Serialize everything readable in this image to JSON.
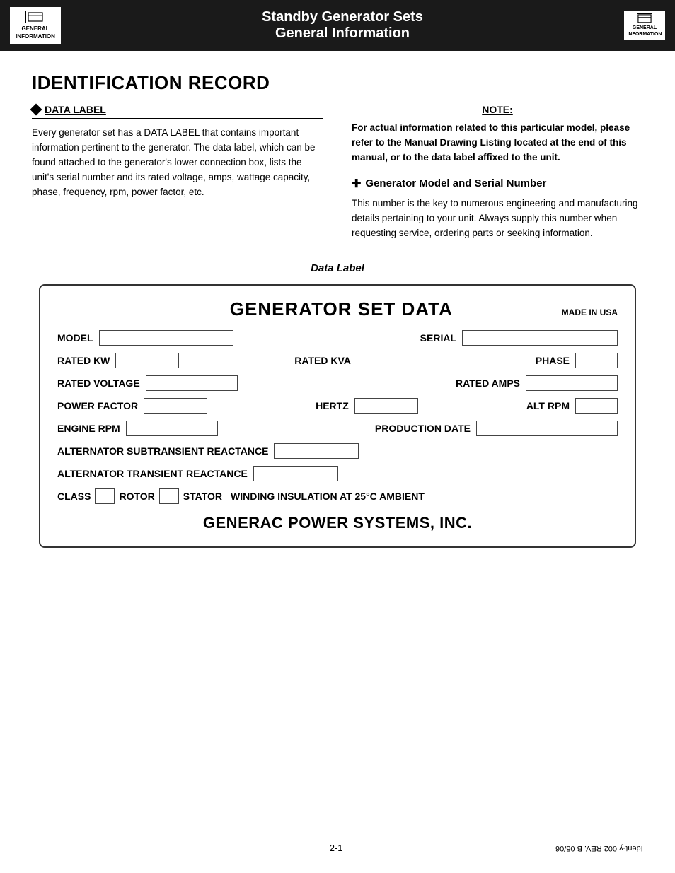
{
  "header": {
    "title_line1": "Standby Generator Sets",
    "title_line2": "General Information",
    "logo_left_line1": "GENERAL",
    "logo_left_line2": "INFORMATION",
    "logo_right_line1": "GENERAL",
    "logo_right_line2": "INFORMATION"
  },
  "identification_record": {
    "title": "IDENTIFICATION RECORD",
    "data_label_heading": "DATA LABEL",
    "data_label_body": "Every generator set has a DATA LABEL that contains important information pertinent to the generator. The data label, which can be found attached to the generator's lower connection box, lists the unit's serial number and its rated voltage, amps, wattage capacity, phase, frequency, rpm, power factor, etc.",
    "note_label": "NOTE:",
    "note_text": "For actual information related to this particular model, please refer to the Manual Drawing Listing located at the end of this manual, or to the data label affixed to the unit.",
    "gen_model_heading": "Generator Model and Serial Number",
    "gen_model_body": "This number is the key to numerous engineering and manufacturing details pertaining to your unit. Always supply this number when requesting service, ordering parts or seeking information."
  },
  "data_label_section": {
    "caption": "Data Label",
    "gen_set_data_title": "GENERATOR SET DATA",
    "made_in_usa": "MADE IN USA",
    "field_model": "MODEL",
    "field_serial": "SERIAL",
    "field_rated_kw": "RATED KW",
    "field_rated_kva": "RATED KVA",
    "field_phase": "PHASE",
    "field_rated_voltage": "RATED VOLTAGE",
    "field_rated_amps": "RATED AMPS",
    "field_power_factor": "POWER FACTOR",
    "field_hertz": "HERTZ",
    "field_alt_rpm": "ALT RPM",
    "field_engine_rpm": "ENGINE RPM",
    "field_production_date": "PRODUCTION DATE",
    "field_alt_subtransient": "ALTERNATOR SUBTRANSIENT REACTANCE",
    "field_alt_transient": "ALTERNATOR TRANSIENT REACTANCE",
    "field_class": "CLASS",
    "field_rotor": "ROTOR",
    "field_stator": "STATOR",
    "field_winding": "WINDING INSULATION AT 25°C AMBIENT",
    "company_name": "GENERAC POWER SYSTEMS, INC."
  },
  "footer": {
    "page_number": "2-1",
    "revision": "Ident-y 002  REV. B  05/06"
  }
}
